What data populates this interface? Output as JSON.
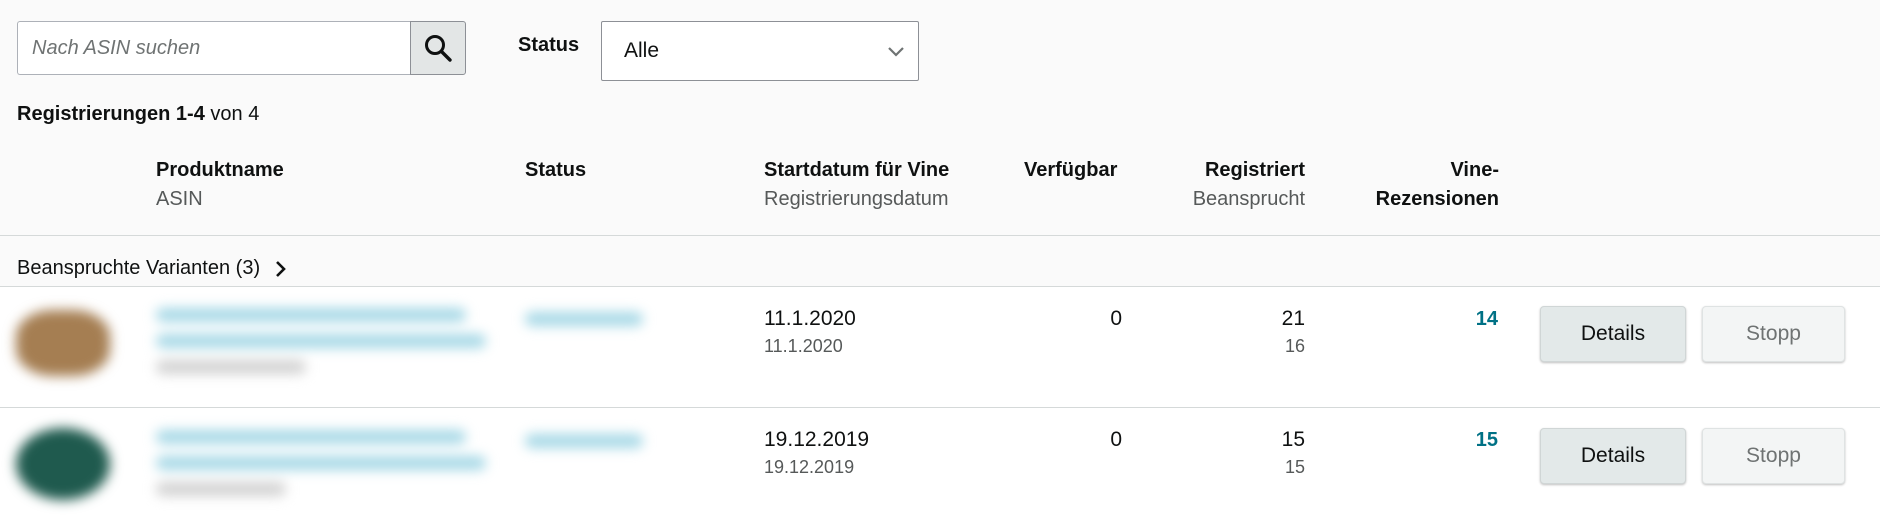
{
  "search": {
    "placeholder": "Nach ASIN suchen",
    "icon": "search-icon"
  },
  "filter": {
    "label": "Status",
    "selected": "Alle"
  },
  "summary": {
    "range": "Registrierungen 1-4",
    "rest": " von 4"
  },
  "table": {
    "headers": {
      "product": "Produktname",
      "product_sub": "ASIN",
      "status": "Status",
      "start": "Startdatum für Vine",
      "start_sub": "Registrierungsdatum",
      "available": "Verfügbar",
      "registered": "Registriert",
      "registered_sub": "Beansprucht",
      "reviews_1": "Vine-",
      "reviews_2": "Rezensionen"
    },
    "variants_label": "Beanspruchte Varianten (3)",
    "rows": [
      {
        "start": "11.1.2020",
        "registered_date": "11.1.2020",
        "available": "0",
        "registered": "21",
        "claimed": "16",
        "reviews": "14",
        "details": "Details",
        "stop": "Stopp"
      },
      {
        "start": "19.12.2019",
        "registered_date": "19.12.2019",
        "available": "0",
        "registered": "15",
        "claimed": "15",
        "reviews": "15",
        "details": "Details",
        "stop": "Stopp"
      }
    ]
  },
  "colors": {
    "link": "#007185",
    "page_bg": "#fafafa"
  }
}
